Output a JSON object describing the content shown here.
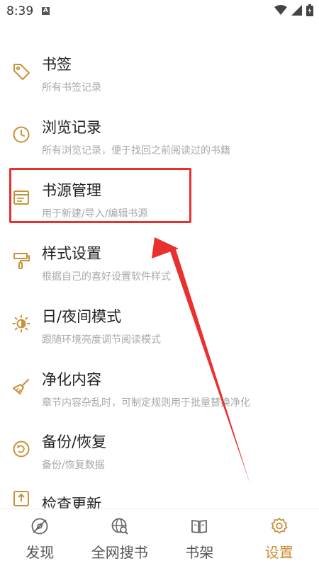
{
  "status_bar": {
    "time": "8:39",
    "notification": "A"
  },
  "menu": {
    "items": [
      {
        "title": "书签",
        "subtitle": "所有书签记录",
        "icon": "bookmark-tag-icon"
      },
      {
        "title": "浏览记录",
        "subtitle": "所有浏览记录，便于找回之前阅读过的书籍",
        "icon": "clock-icon"
      },
      {
        "title": "书源管理",
        "subtitle": "用于新建/导入/编辑书源",
        "icon": "book-source-icon"
      },
      {
        "title": "样式设置",
        "subtitle": "根据自己的喜好设置软件样式",
        "icon": "paint-roller-icon"
      },
      {
        "title": "日/夜间模式",
        "subtitle": "跟随环境亮度调节阅读模式",
        "icon": "sun-moon-icon"
      },
      {
        "title": "净化内容",
        "subtitle": "章节内容杂乱时，可制定规则用于批量替换净化",
        "icon": "broom-icon"
      },
      {
        "title": "备份/恢复",
        "subtitle": "备份/恢复数据",
        "icon": "restore-icon"
      },
      {
        "title": "检查更新",
        "subtitle": "",
        "icon": "upload-icon"
      }
    ]
  },
  "bottom_nav": {
    "items": [
      {
        "label": "发现",
        "icon": "compass-icon"
      },
      {
        "label": "全网搜书",
        "icon": "globe-search-icon"
      },
      {
        "label": "书架",
        "icon": "open-book-icon"
      },
      {
        "label": "设置",
        "icon": "gear-icon"
      }
    ],
    "active_index": 3
  },
  "colors": {
    "accent": "#c8913a",
    "highlight": "#e8312f"
  }
}
